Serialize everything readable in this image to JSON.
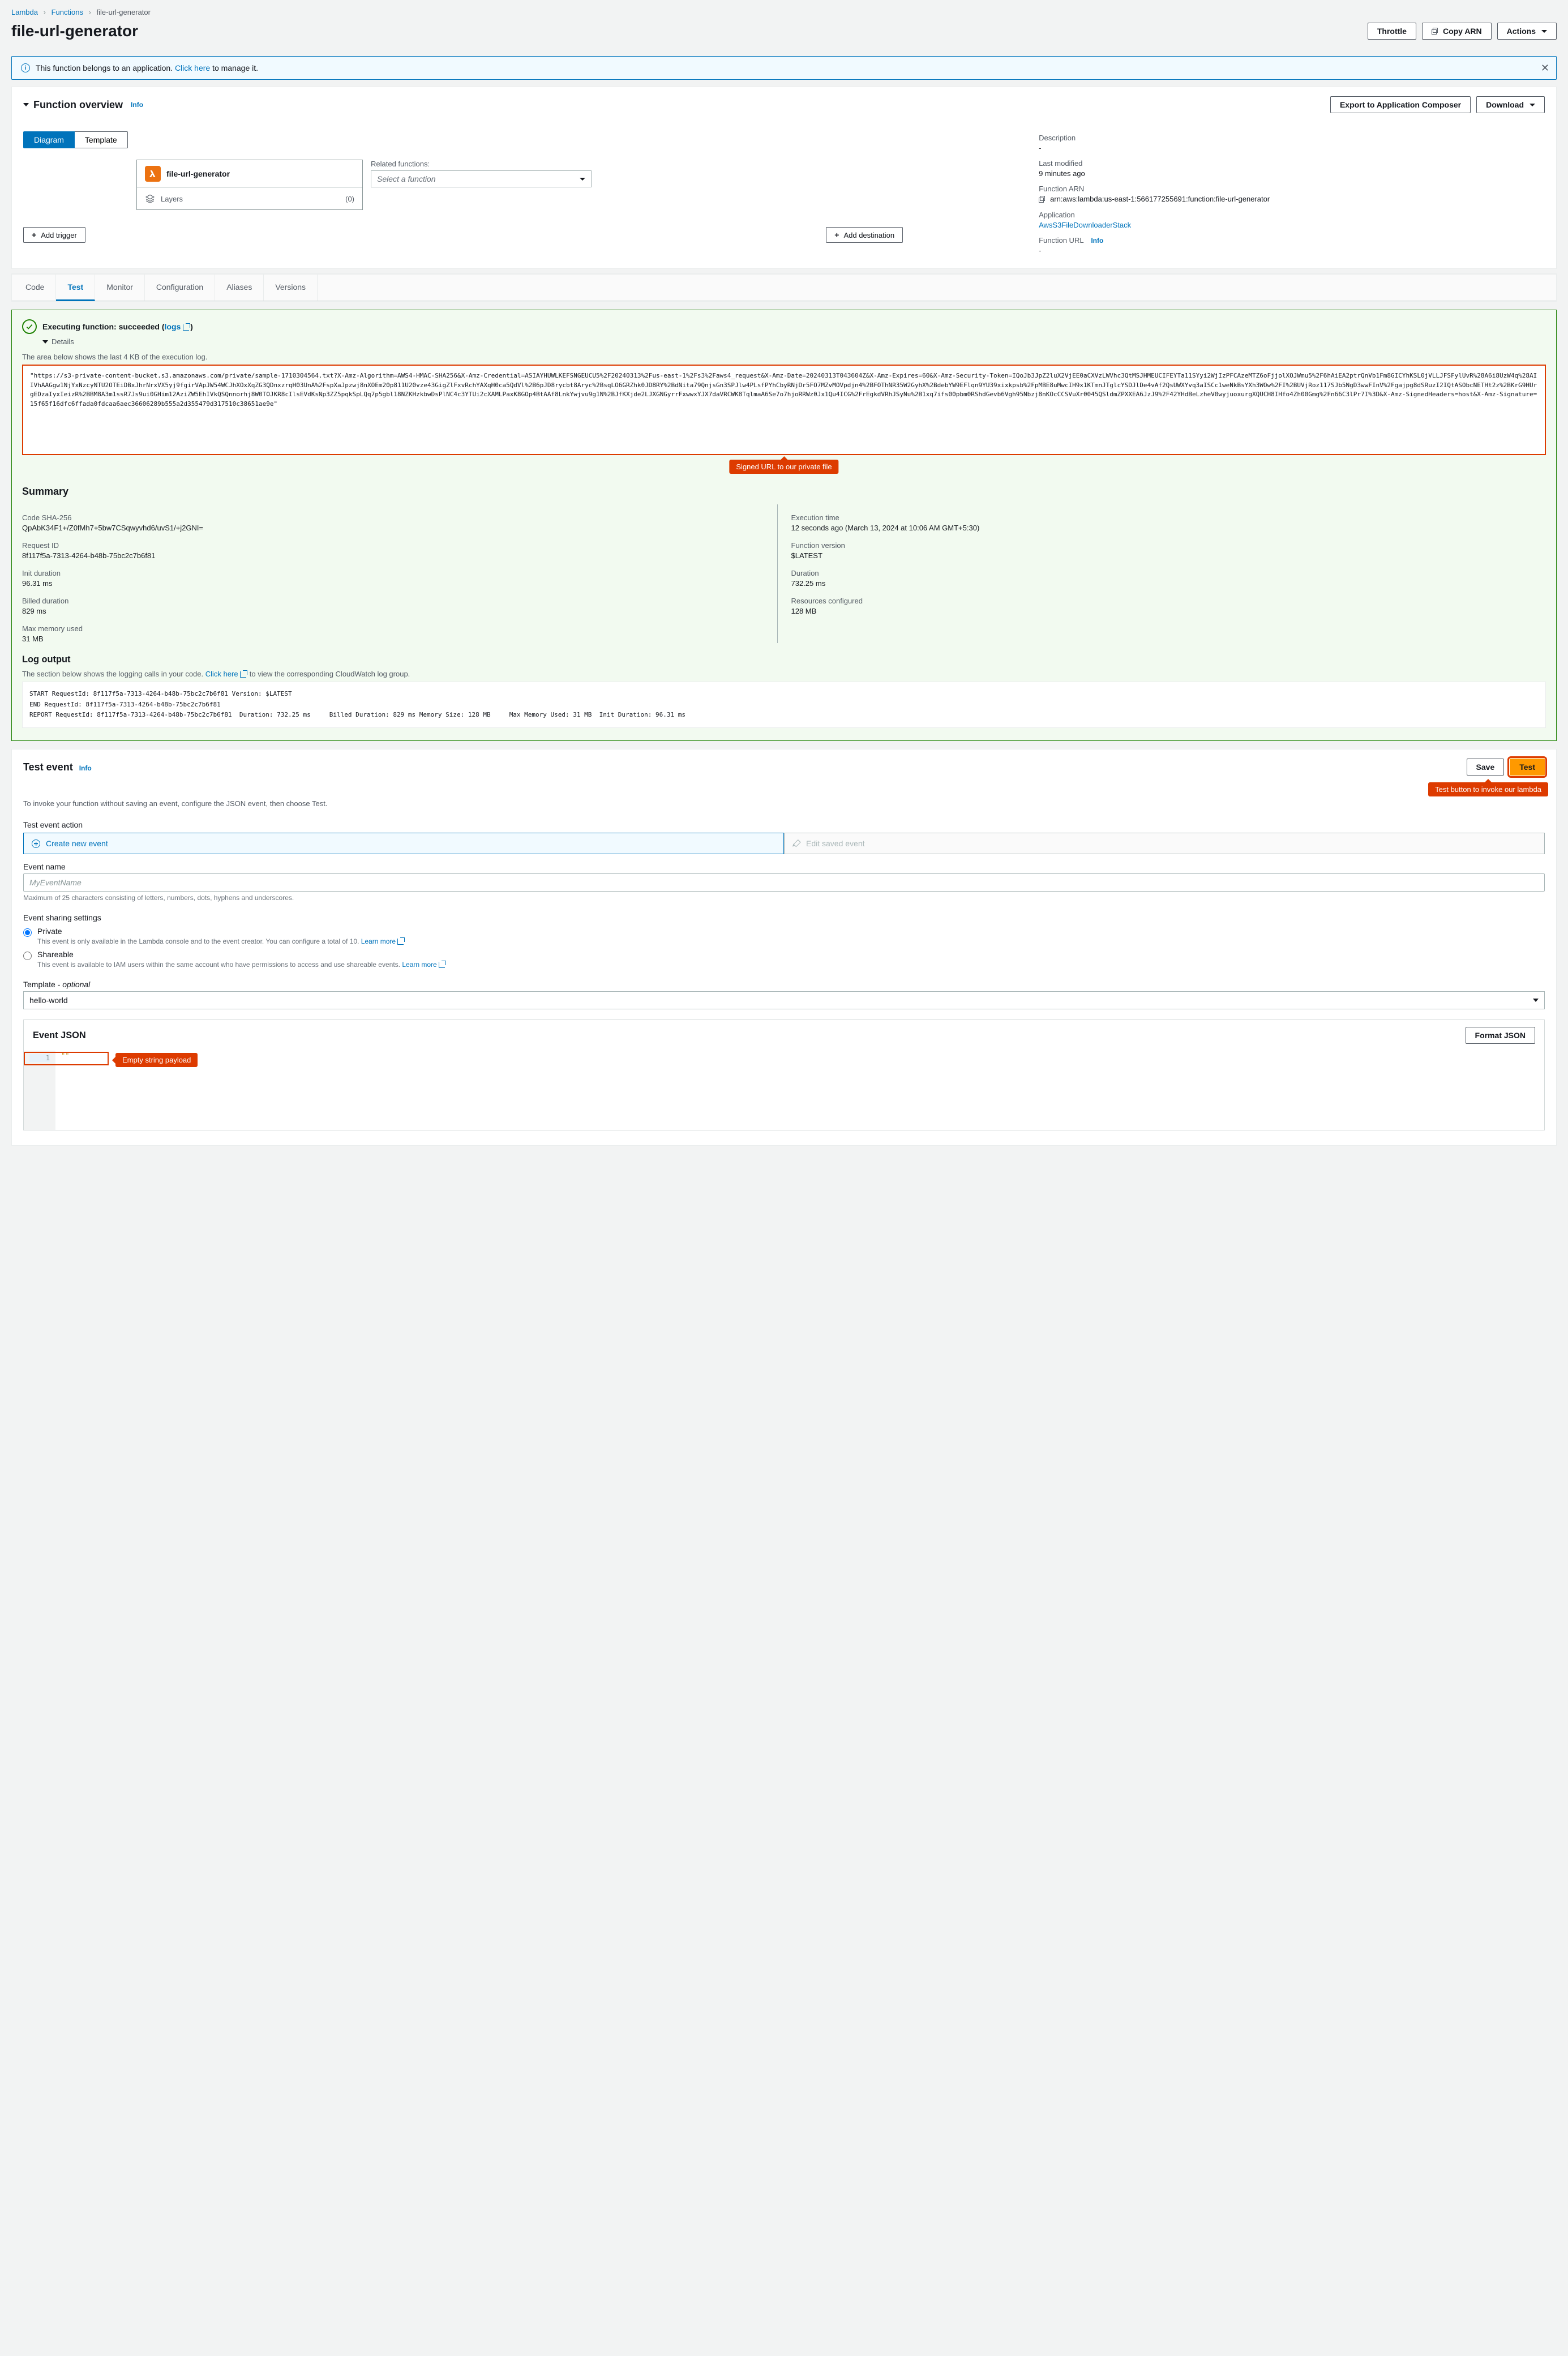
{
  "breadcrumb": {
    "root": "Lambda",
    "mid": "Functions",
    "leaf": "file-url-generator"
  },
  "title": "file-url-generator",
  "header_buttons": {
    "throttle": "Throttle",
    "copy_arn": "Copy ARN",
    "actions": "Actions"
  },
  "info_banner": {
    "prefix": "This function belongs to an application. ",
    "link": "Click here",
    "suffix": " to manage it."
  },
  "overview": {
    "title": "Function overview",
    "info": "Info",
    "export": "Export to Application Composer",
    "download": "Download",
    "tabs": {
      "diagram": "Diagram",
      "template": "Template"
    },
    "node_name": "file-url-generator",
    "layers": "Layers",
    "layers_count": "(0)",
    "related_label": "Related functions:",
    "related_placeholder": "Select a function",
    "add_trigger": "Add trigger",
    "add_destination": "Add destination",
    "desc_label": "Description",
    "desc_value": "-",
    "lastmod_label": "Last modified",
    "lastmod_value": "9 minutes ago",
    "arn_label": "Function ARN",
    "arn_value": "arn:aws:lambda:us-east-1:566177255691:function:file-url-generator",
    "app_label": "Application",
    "app_value": "AwsS3FileDownloaderStack",
    "url_label": "Function URL",
    "url_info": "Info",
    "url_value": "-"
  },
  "tabs": {
    "code": "Code",
    "test": "Test",
    "monitor": "Monitor",
    "config": "Configuration",
    "aliases": "Aliases",
    "versions": "Versions"
  },
  "exec": {
    "title_prefix": "Executing function: ",
    "status": "succeeded",
    "logs_link": "logs",
    "details": "Details",
    "area_note": "The area below shows the last 4 KB of the execution log.",
    "log_body": "\"https://s3-private-content-bucket.s3.amazonaws.com/private/sample-1710304564.txt?X-Amz-Algorithm=AWS4-HMAC-SHA256&X-Amz-Credential=ASIAYHUWLKEFSNGEUCU5%2F20240313%2Fus-east-1%2Fs3%2Faws4_request&X-Amz-Date=20240313T043604Z&X-Amz-Expires=60&X-Amz-Security-Token=IQoJb3JpZ2luX2VjEE0aCXVzLWVhc3QtMSJHMEUCIFEYTa11SYyi2WjIzPFCAzeMTZ6oFjjolXOJWmu5%2F6hAiEA2ptrQnVb1Fm8GICYhKSL0jVLLJFSFylUvR%28A6i8UzW4q%28AIIVhAAGgw1NjYxNzcyNTU2OTEiDBxJhrNrxVX5yj9fgirVApJW54WCJhXOxXqZG3QDnxzrqH03UnA%2FspXaJpzwj8nXOEm20p811U20vze43GigZlFxvRchYAXqH0ca5QdVl%2B6pJD8rycbt8Aryc%2BsqLO6GRZhk0JD8RY%2BdNita79QnjsGn3SPJlw4PLsfPYhCbyRNjDr5FO7MZvMOVpdjn4%2BFOThNR35W2GyhX%2BdebYW9EFlqn9YU39xixkpsb%2FpMBE8uMwcIH9x1KTmnJTglcYSDJlDe4vAf2QsUWXYvq3aISCc1weNkBsYXh3WOw%2FI%2BUVjRoz117SJb5NgD3wwFInV%2Fgajpg8dSRuzI2IQtASObcNETHt2z%2BKrG9HUrgEDzaIyxIeizR%2BBM8A3m1ssR7Js9ui0GHim12AziZW5EhIVkQSQnnorhj8W0TOJKR8cIlsEVdKsNp3ZZ5pqkSpLQq7p5gbl18NZKHzkbwDsPlNC4c3YTUi2cXAMLPaxK8GOp4BtAAf8LnkYwjvu9g1N%2BJfKXjde2LJXGNGyrrFxwwxYJX7daVRCWK8TqlmaA6Se7o7hjoRRWz0Jx1Qu4ICG%2FrEgkdVRhJSyNu%2B1xq7ifs00pbm0RShdGevb6Vgh95Nbzj8nKOcCCSVuXr0045QSldmZPXXEA6JzJ9%2F42YHdBeLzheV0wyjuoxurgXQUCH8IHfo4Zh00Gmg%2Fn66C3lPr7I%3D&X-Amz-SignedHeaders=host&X-Amz-Signature=15f65f16dfc6ffada0fdcaa6aec36606289b555a2d355479d317510c38651ae9e\"",
    "callout_url": "Signed URL to our private file"
  },
  "summary": {
    "title": "Summary",
    "sha_label": "Code SHA-256",
    "sha_value": "QpAbK34F1+/Z0fMh7+5bw7CSqwyvhd6/uvS1/+j2GNI=",
    "reqid_label": "Request ID",
    "reqid_value": "8f117f5a-7313-4264-b48b-75bc2c7b6f81",
    "init_label": "Init duration",
    "init_value": "96.31 ms",
    "billed_label": "Billed duration",
    "billed_value": "829 ms",
    "maxmem_label": "Max memory used",
    "maxmem_value": "31 MB",
    "exec_label": "Execution time",
    "exec_value": "12 seconds ago (March 13, 2024 at 10:06 AM GMT+5:30)",
    "ver_label": "Function version",
    "ver_value": "$LATEST",
    "dur_label": "Duration",
    "dur_value": "732.25 ms",
    "res_label": "Resources configured",
    "res_value": "128 MB"
  },
  "log_output": {
    "title": "Log output",
    "line": "The section below shows the logging calls in your code. ",
    "link": "Click here",
    "suffix": " to view the corresponding CloudWatch log group.",
    "body": "START RequestId: 8f117f5a-7313-4264-b48b-75bc2c7b6f81 Version: $LATEST\nEND RequestId: 8f117f5a-7313-4264-b48b-75bc2c7b6f81\nREPORT RequestId: 8f117f5a-7313-4264-b48b-75bc2c7b6f81  Duration: 732.25 ms     Billed Duration: 829 ms Memory Size: 128 MB     Max Memory Used: 31 MB  Init Duration: 96.31 ms"
  },
  "test_event": {
    "title": "Test event",
    "info": "Info",
    "save": "Save",
    "test": "Test",
    "test_callout": "Test button to invoke our lambda",
    "invoke_note": "To invoke your function without saving an event, configure the JSON event, then choose Test.",
    "action_label": "Test event action",
    "create": "Create new event",
    "edit": "Edit saved event",
    "event_name_label": "Event name",
    "event_name_placeholder": "MyEventName",
    "event_name_hint": "Maximum of 25 characters consisting of letters, numbers, dots, hyphens and underscores.",
    "sharing_label": "Event sharing settings",
    "private_label": "Private",
    "private_desc_prefix": "This event is only available in the Lambda console and to the event creator. You can configure a total of 10. ",
    "learn_more": "Learn more",
    "shareable_label": "Shareable",
    "shareable_desc_prefix": "This event is available to IAM users within the same account who have permissions to access and use shareable events. ",
    "template_label_prefix": "Template - ",
    "template_optional": "optional",
    "template_value": "hello-world",
    "event_json_title": "Event JSON",
    "format_button": "Format JSON",
    "json_content": "\"\"",
    "json_callout": "Empty string payload"
  }
}
